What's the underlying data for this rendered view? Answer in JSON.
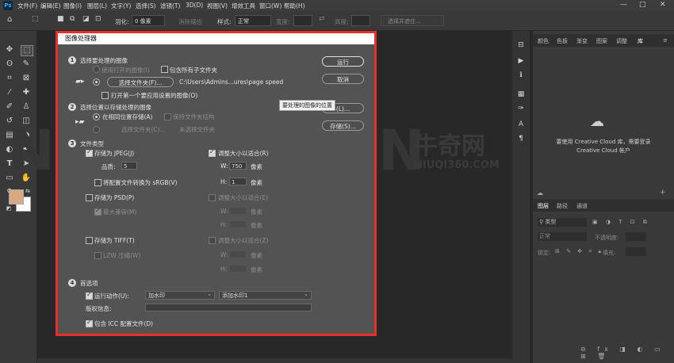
{
  "app": {
    "logo": "Ps"
  },
  "menubar": {
    "items": [
      "文件(F)",
      "编辑(E)",
      "图像(I)",
      "图层(L)",
      "文字(Y)",
      "选择(S)",
      "滤镜(T)",
      "3D(D)",
      "视图(V)",
      "增效工具",
      "窗口(W)",
      "帮助(H)"
    ],
    "window_controls": [
      "—",
      "□",
      "✕"
    ]
  },
  "options": {
    "feather_label": "羽化:",
    "feather_value": "0 像素",
    "antialias_label": "消除锯齿",
    "style_label": "样式:",
    "style_value": "正常",
    "width_label": "宽度:",
    "height_label": "高度:",
    "select_mask_label": "选择并遮住..."
  },
  "dialog": {
    "title": "图像处理器",
    "s1": {
      "num": "1",
      "title": "选择要处理的图像",
      "use_open": "使用打开的图像(I)",
      "include_sub": "包含所有子文件夹",
      "select_folder_btn": "选择文件夹(F)...",
      "path": "C:\\Users\\Admins...ures\\page speed",
      "open_first": "打开第一个要应用设置的图像(O)"
    },
    "s2": {
      "num": "2",
      "title": "选择位置以存储处理的图像",
      "same_location": "在相同位置存储(A)",
      "keep_structure": "保持文件夹结构",
      "select_folder_btn": "选择文件夹(C)...",
      "no_folder": "未选择文件夹",
      "tooltip": "要处理的图像的位置"
    },
    "s3": {
      "num": "3",
      "title": "文件类型",
      "jpeg": "存储为 JPEG(J)",
      "resize_jpeg": "调整大小以适合(R)",
      "quality_label": "品质:",
      "quality_value": "5",
      "w_label": "W:",
      "w_value": "750",
      "px1": "像素",
      "h_label": "H:",
      "h_value": "1",
      "px2": "像素",
      "srgb": "将配置文件转换为 sRGB(V)",
      "psd": "存储为 PSD(P)",
      "resize_psd": "调整大小以适合(E)",
      "maximize": "最大兼容(M)",
      "psd_w_label": "W:",
      "psd_px1": "像素",
      "psd_h_label": "H:",
      "psd_px2": "像素",
      "tiff": "存储为 TIFF(T)",
      "resize_tiff": "调整大小以适合(Z)",
      "lzw": "LZW 压缩(W)",
      "tiff_w_label": "W:",
      "tiff_px1": "像素",
      "tiff_h_label": "H:",
      "tiff_px2": "像素"
    },
    "s4": {
      "num": "4",
      "title": "首选项",
      "run_action": "运行动作(U):",
      "action_set": "加水印",
      "action": "添加水印1",
      "copyright_label": "版权信息:",
      "copyright_value": "",
      "icc": "包含 ICC 配置文件(D)"
    },
    "buttons": {
      "run": "运行",
      "cancel": "取消",
      "load": "(L)...",
      "save": "存储(S)..."
    }
  },
  "watermark": {
    "brand_cn": "牛奇网",
    "brand_en": "NIUQI360.COM"
  },
  "panels": {
    "top_tabs": [
      "颜色",
      "色板",
      "渐变",
      "图案",
      "调整",
      "库"
    ],
    "cc_message_line1": "要使用 Creative Cloud 库，需要登录",
    "cc_message_line2": "Creative Cloud 帐户",
    "layer_tabs": [
      "图层",
      "路径",
      "通道"
    ],
    "kind_label": "类型",
    "blend_mode": "正常",
    "opacity_label": "不透明度:",
    "lock_label": "锁定:",
    "fill_label": "填充:"
  },
  "colors": {
    "foreground": "#d9aa82",
    "background": "#ffffff",
    "dialog_highlight": "#e8302b"
  }
}
